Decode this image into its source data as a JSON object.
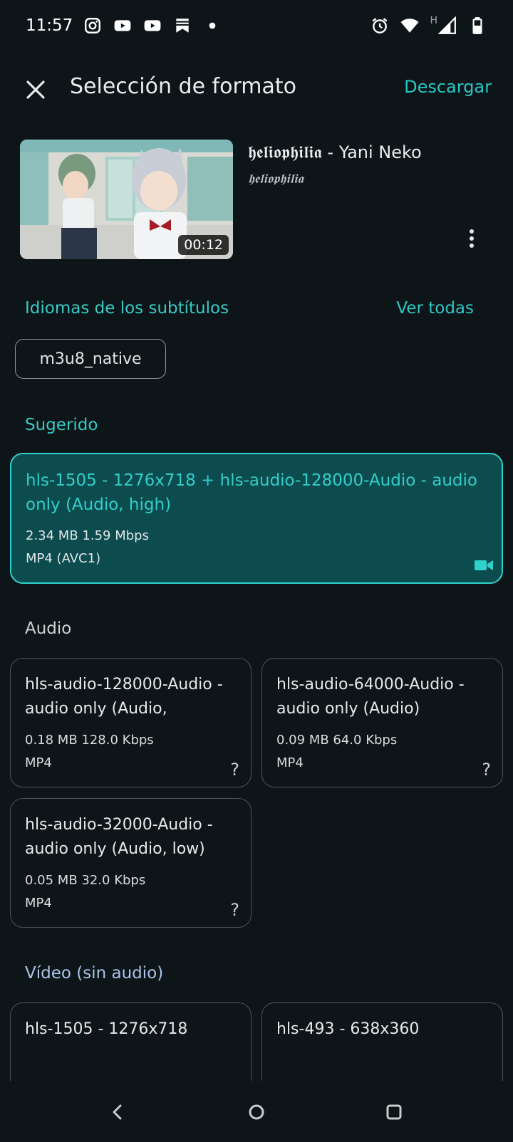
{
  "status": {
    "time": "11:57",
    "network_label": "H"
  },
  "appbar": {
    "title": "Selección de formato",
    "download_label": "Descargar"
  },
  "media": {
    "title": "𝖍𝖊𝖑𝖎𝖔𝖕𝖍𝖎𝖑𝖎𝖆 - Yani Neko",
    "channel": "𝖍𝖊𝖑𝖎𝖔𝖕𝖍𝖎𝖑𝖎𝖆",
    "duration": "00:12"
  },
  "subtitles": {
    "heading": "Idiomas de los subtítulos",
    "see_all": "Ver todas",
    "chip": "m3u8_native"
  },
  "suggested": {
    "heading": "Sugerido",
    "card": {
      "title": "hls-1505 - 1276x718 + hls-audio-128000-Audio - audio only (Audio, high)",
      "meta1": "2.34 MB 1.59 Mbps",
      "meta2": "MP4 (AVC1)",
      "icon": "videocam-icon"
    }
  },
  "audio": {
    "heading": "Audio",
    "cards": [
      {
        "title": "hls-audio-128000-Audio - audio only (Audio,",
        "meta1": "0.18 MB 128.0 Kbps",
        "meta2": "MP4",
        "icon": "?"
      },
      {
        "title": "hls-audio-64000-Audio - audio only (Audio)",
        "meta1": "0.09 MB 64.0 Kbps",
        "meta2": "MP4",
        "icon": "?"
      },
      {
        "title": "hls-audio-32000-Audio - audio only (Audio, low)",
        "meta1": "0.05 MB 32.0 Kbps",
        "meta2": "MP4",
        "icon": "?"
      }
    ]
  },
  "video_only": {
    "heading": "Vídeo (sin audio)",
    "cards": [
      {
        "title": "hls-1505 - 1276x718"
      },
      {
        "title": "hls-493 - 638x360"
      }
    ]
  },
  "colors": {
    "accent": "#2ec6c2",
    "background": "#0e1518",
    "selected_card": "#0c4c4f"
  }
}
